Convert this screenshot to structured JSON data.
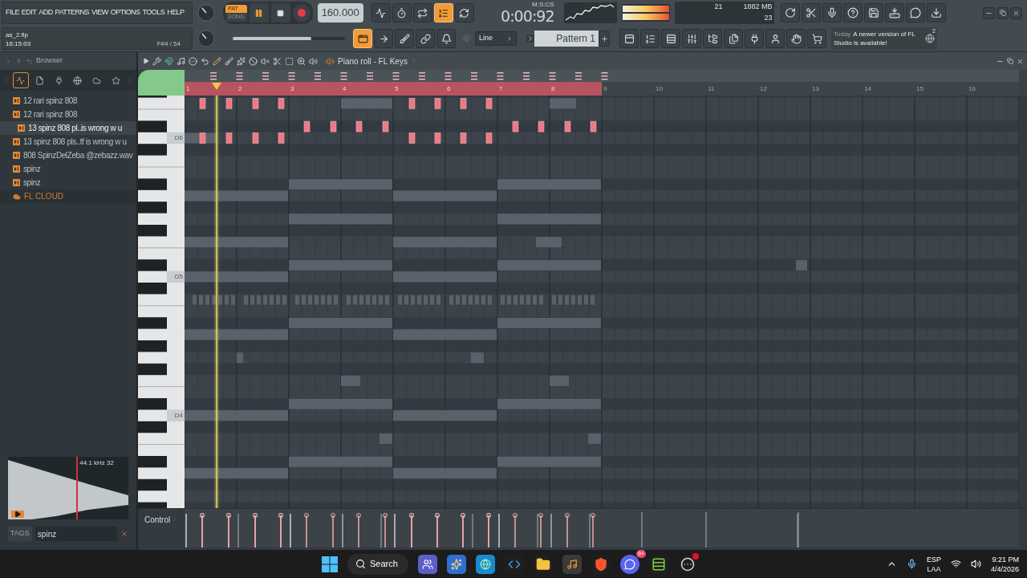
{
  "menu": [
    "FILE",
    "EDIT",
    "ADD",
    "PATTERNS",
    "VIEW",
    "OPTIONS",
    "TOOLS",
    "HELP"
  ],
  "project": {
    "file": "as_2.flp",
    "time": "16:15:03",
    "hint": "F#4 / 54"
  },
  "transport": {
    "pat": "PAT",
    "song": "SONG",
    "pat_selected": true,
    "playing": true,
    "tempo": "160.000"
  },
  "row1_toggles": [
    {
      "on": false
    },
    {
      "on": false
    },
    {
      "on": false
    },
    {
      "on": true
    },
    {
      "on": false
    }
  ],
  "row2_toggles": [
    {
      "on": true
    },
    {
      "on": false
    },
    {
      "on": false
    },
    {
      "on": false
    },
    {
      "on": false
    }
  ],
  "main_slider": {
    "level": 0.7
  },
  "clock": {
    "time": "0:00:92",
    "unit": "M:S:CS"
  },
  "performance": {
    "cpu": "21",
    "memory": "1882 MB",
    "polyphony": "23"
  },
  "snap": "Line",
  "pattern": "Pattern 1",
  "news": {
    "when": "Today",
    "message": "A newer version of FL Studio is available!",
    "count": "2"
  },
  "browser": {
    "title": "Browser",
    "tabs": [
      {
        "selected": true
      },
      {
        "selected": false
      },
      {
        "selected": false
      },
      {
        "selected": false
      },
      {
        "selected": false
      },
      {
        "selected": false
      }
    ],
    "items": [
      {
        "label": "12 rari spinz 808",
        "selected": false
      },
      {
        "label": "12 rari spinz 808",
        "selected": false
      },
      {
        "label": "13 spinz 808 pl..is wrong w u",
        "selected": true
      },
      {
        "label": "13 spinz 808 pls..tf is wrong w u",
        "selected": false
      },
      {
        "label": "808 SpinzDelZeba @zebazz.wav",
        "selected": false
      },
      {
        "label": "spinz",
        "selected": false
      },
      {
        "label": "spinz",
        "selected": false
      }
    ],
    "cloud": "FL CLOUD"
  },
  "sample": {
    "rate": "44.1 kHz",
    "bits": "32"
  },
  "tags": {
    "label": "TAGS",
    "value": "spinz"
  },
  "piano_roll": {
    "title": "Piano roll - FL Keys",
    "key_labels": [
      "D6",
      "D5",
      "D4"
    ],
    "control": "Control",
    "bars": [
      {
        "label": "1",
        "looped": true
      },
      {
        "label": "2",
        "looped": true
      },
      {
        "label": "3",
        "looped": true
      },
      {
        "label": "4",
        "looped": true
      },
      {
        "label": "5",
        "looped": true
      },
      {
        "label": "6",
        "looped": true
      },
      {
        "label": "7",
        "looped": true
      },
      {
        "label": "8",
        "looped": true
      },
      {
        "label": "9",
        "looped": false
      },
      {
        "label": "10",
        "looped": false
      },
      {
        "label": "11",
        "looped": false
      },
      {
        "label": "12",
        "looped": false
      },
      {
        "label": "13",
        "looped": false
      },
      {
        "label": "14",
        "looped": false
      },
      {
        "label": "15",
        "looped": false
      },
      {
        "label": "16",
        "looped": false
      }
    ]
  },
  "taskbar": {
    "search": "Search",
    "chat_badge": "9+",
    "language": "ESP",
    "layout": "LAA",
    "time": "9:21 PM",
    "date": "4/4/2026"
  }
}
